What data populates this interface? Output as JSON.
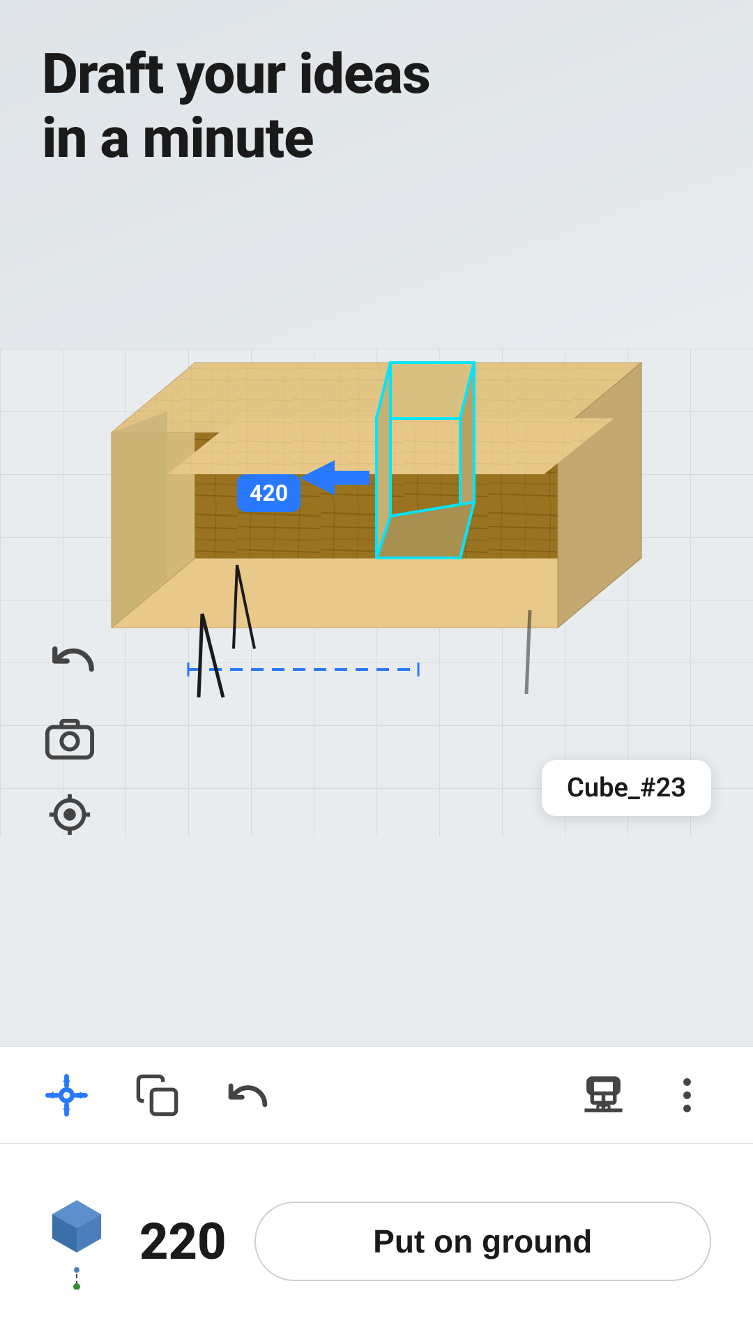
{
  "header": {
    "title_line1": "Draft your ideas",
    "title_line2": "in a minute"
  },
  "scene": {
    "cube_label": "Cube_#23",
    "measurement": "420",
    "height_value": "220"
  },
  "toolbar": {
    "icons": {
      "move": "move-icon",
      "duplicate": "duplicate-icon",
      "undo": "undo-icon",
      "paint": "paint-icon",
      "more": "more-options-icon"
    }
  },
  "bottom_panel": {
    "height_label": "220",
    "put_on_ground_label": "Put on ground"
  },
  "left_controls": {
    "undo_label": "Undo",
    "camera_label": "Camera",
    "target_label": "Target"
  },
  "colors": {
    "accent_blue": "#2979ff",
    "selection_cyan": "#00e5ff",
    "background": "#e8ecef",
    "white": "#ffffff",
    "dark_text": "#1a1a1a"
  }
}
